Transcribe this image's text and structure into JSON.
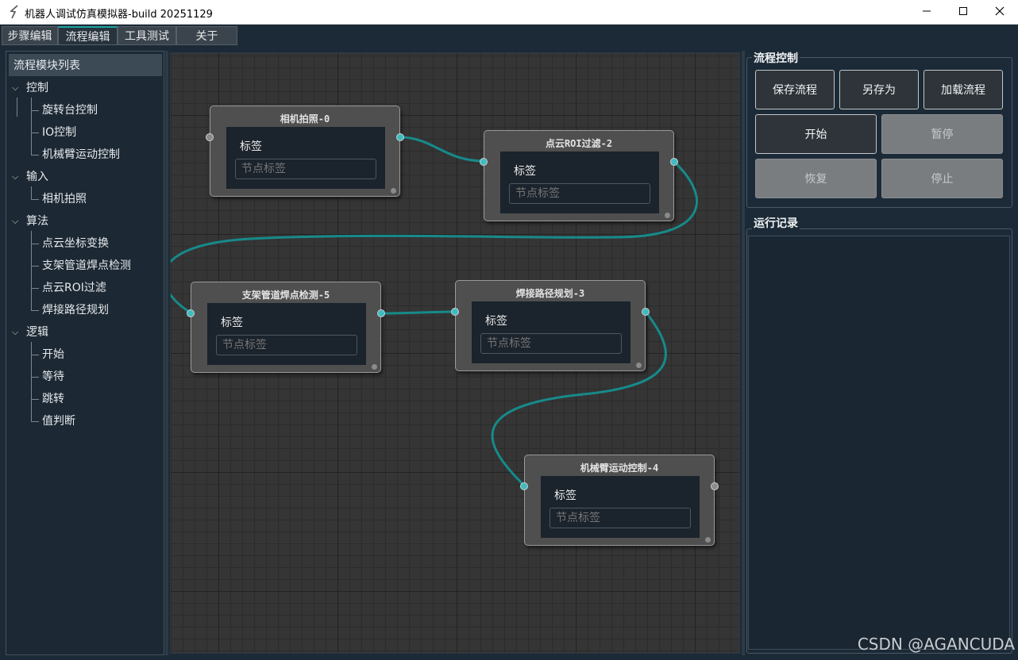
{
  "window": {
    "title": "机器人调试仿真模拟器-build 20251129"
  },
  "tabs": [
    {
      "label": "步骤编辑"
    },
    {
      "label": "流程编辑"
    },
    {
      "label": "工具测试"
    },
    {
      "label": "关于"
    }
  ],
  "module_list": {
    "header": "流程模块列表",
    "groups": [
      {
        "label": "控制",
        "items": [
          "旋转台控制",
          "IO控制",
          "机械臂运动控制"
        ]
      },
      {
        "label": "输入",
        "items": [
          "相机拍照"
        ]
      },
      {
        "label": "算法",
        "items": [
          "点云坐标变换",
          "支架管道焊点检测",
          "点云ROI过滤",
          "焊接路径规划"
        ]
      },
      {
        "label": "逻辑",
        "items": [
          "开始",
          "等待",
          "跳转",
          "值判断"
        ]
      }
    ]
  },
  "flow_nodes": [
    {
      "title": "相机拍照-0",
      "label": "标签",
      "placeholder": "节点标签"
    },
    {
      "title": "点云ROI过滤-2",
      "label": "标签",
      "placeholder": "节点标签"
    },
    {
      "title": "支架管道焊点检测-5",
      "label": "标签",
      "placeholder": "节点标签"
    },
    {
      "title": "焊接路径规划-3",
      "label": "标签",
      "placeholder": "节点标签"
    },
    {
      "title": "机械臂运动控制-4",
      "label": "标签",
      "placeholder": "节点标签"
    }
  ],
  "connections": [
    {
      "from": "相机拍照-0",
      "to": "点云ROI过滤-2"
    },
    {
      "from": "点云ROI过滤-2",
      "to": "支架管道焊点检测-5"
    },
    {
      "from": "支架管道焊点检测-5",
      "to": "焊接路径规划-3"
    },
    {
      "from": "焊接路径规划-3",
      "to": "机械臂运动控制-4"
    }
  ],
  "flow_control": {
    "title": "流程控制",
    "buttons": {
      "save": "保存流程",
      "save_as": "另存为",
      "load": "加载流程",
      "start": "开始",
      "pause": "暂停",
      "resume": "恢复",
      "stop": "停止"
    }
  },
  "run_log": {
    "title": "运行记录"
  },
  "watermark": "CSDN @AGANCUDA",
  "colors": {
    "accent": "#1fa5a0",
    "connection": "#178a8a",
    "port_active": "#3fbcbf",
    "port_idle": "#8c8c8c",
    "background": "#1b2a36",
    "disabled_button": "#7a7d80"
  }
}
